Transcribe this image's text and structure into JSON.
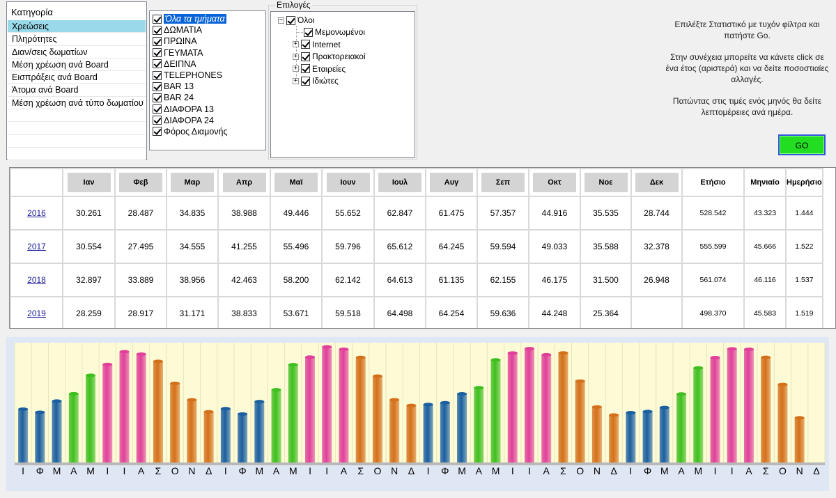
{
  "category": {
    "title": "Κατηγορία",
    "items": [
      "Χρεώσεις",
      "Πληρότητες",
      "Διαν/σεις δωματίων",
      "Μέση χρέωση ανά Board",
      "Εισπράξεις ανά Board",
      "Άτομα ανά Board",
      "Μέση χρέωση ανά τύπο δωματίου"
    ],
    "selected_index": 0
  },
  "departments": {
    "items": [
      "Όλα τα τμήματα",
      "ΔΩΜΑΤΙΑ",
      "ΠΡΩΙΝΑ",
      "ΓΕΥΜΑΤΑ",
      "ΔΕΙΠΝΑ",
      "TELEPHONES",
      "BAR 13",
      "BAR 24",
      "ΔΙΑΦΟΡΑ 13",
      "ΔΙΑΦΟΡΑ 24",
      "Φόρος Διαμονής"
    ],
    "all_checked": true
  },
  "options": {
    "legend": "Επιλογές",
    "root": "Όλοι",
    "children": [
      "Μεμονωμένοι",
      "Internet",
      "Πρακτορειακοί",
      "Εταιρείες",
      "Ιδιώτες"
    ],
    "expander_collapse": "−",
    "expander_expand": "+"
  },
  "instructions": {
    "line1": "Επιλέξτε Στατιστικό με τυχόν φίλτρα και πατήστε Go.",
    "line2": "Στην συνέχεια μπορείτε να κάνετε click σε ένα έτος (αριστερά) και να δείτε ποσοστιαίες αλλαγές.",
    "line3": "Πατώντας στις τιμές ενός μηνός θα δείτε λεπτομέρειες ανά ημέρα."
  },
  "go_button": "GO",
  "table": {
    "headers": [
      "Ιαν",
      "Φεβ",
      "Μαρ",
      "Απρ",
      "Μαϊ",
      "Ιουν",
      "Ιουλ",
      "Αυγ",
      "Σεπ",
      "Οκτ",
      "Νοε",
      "Δεκ",
      "Ετήσιο",
      "Μηνιαίο",
      "Ημερήσιο"
    ],
    "rows": [
      {
        "year": "2016",
        "cells": [
          "30.261",
          "28.487",
          "34.835",
          "38.988",
          "49.446",
          "55.652",
          "62.847",
          "61.475",
          "57.357",
          "44.916",
          "35.535",
          "28.744",
          "528.542",
          "43.323",
          "1.444"
        ]
      },
      {
        "year": "2017",
        "cells": [
          "30.554",
          "27.495",
          "34.555",
          "41.255",
          "55.496",
          "59.796",
          "65.612",
          "64.245",
          "59.594",
          "49.033",
          "35.588",
          "32.378",
          "555.599",
          "45.666",
          "1.522"
        ]
      },
      {
        "year": "2018",
        "cells": [
          "32.897",
          "33.889",
          "38.956",
          "42.463",
          "58.200",
          "62.142",
          "64.613",
          "61.135",
          "62.155",
          "46.175",
          "31.500",
          "26.948",
          "561.074",
          "46.116",
          "1.537"
        ]
      },
      {
        "year": "2019",
        "cells": [
          "28.259",
          "28.917",
          "31.171",
          "38.833",
          "53.671",
          "59.518",
          "64.498",
          "64.254",
          "59.636",
          "44.248",
          "25.364",
          "",
          "498.370",
          "45.583",
          "1.519"
        ]
      }
    ]
  },
  "chart_data": {
    "type": "bar",
    "categories": [
      "Ι",
      "Φ",
      "Μ",
      "Α",
      "Μ",
      "Ι",
      "Ι",
      "Α",
      "Σ",
      "Ο",
      "Ν",
      "Δ",
      "Ι",
      "Φ",
      "Μ",
      "Α",
      "Μ",
      "Ι",
      "Ι",
      "Α",
      "Σ",
      "Ο",
      "Ν",
      "Δ",
      "Ι",
      "Φ",
      "Μ",
      "Α",
      "Μ",
      "Ι",
      "Ι",
      "Α",
      "Σ",
      "Ο",
      "Ν",
      "Δ",
      "Ι",
      "Φ",
      "Μ",
      "Α",
      "Μ",
      "Ι",
      "Ι",
      "Α",
      "Σ",
      "Ο",
      "Ν",
      "Δ"
    ],
    "values": [
      30.261,
      28.487,
      34.835,
      38.988,
      49.446,
      55.652,
      62.847,
      61.475,
      57.357,
      44.916,
      35.535,
      28.744,
      30.554,
      27.495,
      34.555,
      41.255,
      55.496,
      59.796,
      65.612,
      64.245,
      59.594,
      49.033,
      35.588,
      32.378,
      32.897,
      33.889,
      38.956,
      42.463,
      58.2,
      62.142,
      64.613,
      61.135,
      62.155,
      46.175,
      31.5,
      26.948,
      28.259,
      28.917,
      31.171,
      38.833,
      53.671,
      59.518,
      64.498,
      64.254,
      59.636,
      44.248,
      25.364,
      0
    ],
    "ylim": [
      0,
      68
    ],
    "grid": true,
    "season_colors": {
      "winter": "#1b5fa0",
      "spring": "#3fbf1f",
      "summer": "#e0409a",
      "autumn": "#d4701a"
    },
    "month_season": [
      "winter",
      "winter",
      "winter",
      "spring",
      "spring",
      "summer",
      "summer",
      "summer",
      "autumn",
      "autumn",
      "autumn",
      "autumn"
    ],
    "background": "#fdfbd6"
  }
}
